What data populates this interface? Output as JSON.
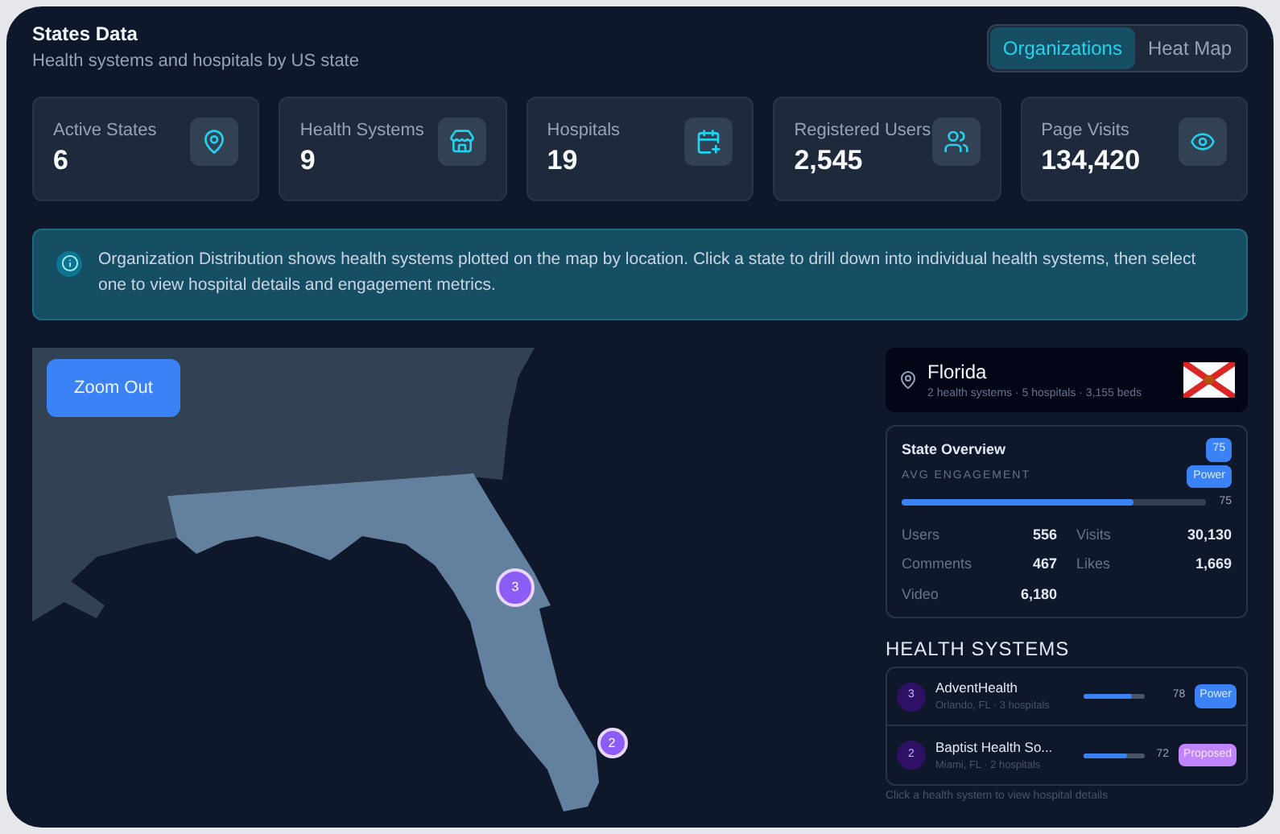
{
  "header": {
    "title": "States Data",
    "subtitle": "Health systems and hospitals by US state"
  },
  "view_tabs": [
    {
      "label": "Organizations",
      "selected": true
    },
    {
      "label": "Heat Map",
      "selected": false
    }
  ],
  "stats": [
    {
      "label": "Active States",
      "value": "6"
    },
    {
      "label": "Health Systems",
      "value": "9"
    },
    {
      "label": "Hospitals",
      "value": "19"
    },
    {
      "label": "Registered Users",
      "value": "2,545"
    },
    {
      "label": "Page Visits",
      "value": "134,420"
    }
  ],
  "notice": {
    "text": "Organization Distribution shows health systems plotted on the map by location. Click a state to drill down into individual health systems, then select one to view hospital details and engagement metrics."
  },
  "map": {
    "button": "Zoom Out",
    "markers": [
      {
        "label": "3"
      },
      {
        "label": "2"
      }
    ]
  },
  "state": {
    "name": "Florida",
    "details": "2 health systems · 5 hospitals · 3,155 beds"
  },
  "overview": {
    "title": "State Overview",
    "score": "75",
    "subtitle": "AVG ENGAGEMENT",
    "tier": "Power",
    "kind": "power",
    "level": 0.76,
    "reading": "75",
    "metrics": [
      {
        "label": "Users",
        "value": "556"
      },
      {
        "label": "Visits",
        "value": "30,130"
      },
      {
        "label": "Comments",
        "value": "467"
      },
      {
        "label": "Likes",
        "value": "1,669"
      },
      {
        "label": "Video",
        "value": "6,180"
      }
    ]
  },
  "health_systems": {
    "title": "HEALTH SYSTEMS",
    "items": [
      {
        "rank": "3",
        "name": "AdventHealth",
        "details": "Orlando, FL · 3 hospitals",
        "level": 0.78,
        "score": "78",
        "tier": "Power",
        "kind": "power"
      },
      {
        "rank": "2",
        "name": "Baptist Health So...",
        "details": "Miami, FL · 2 hospitals",
        "level": 0.72,
        "score": "72",
        "tier": "Proposed",
        "kind": "proposed"
      }
    ],
    "hint": "Click a health system to view hospital details"
  }
}
